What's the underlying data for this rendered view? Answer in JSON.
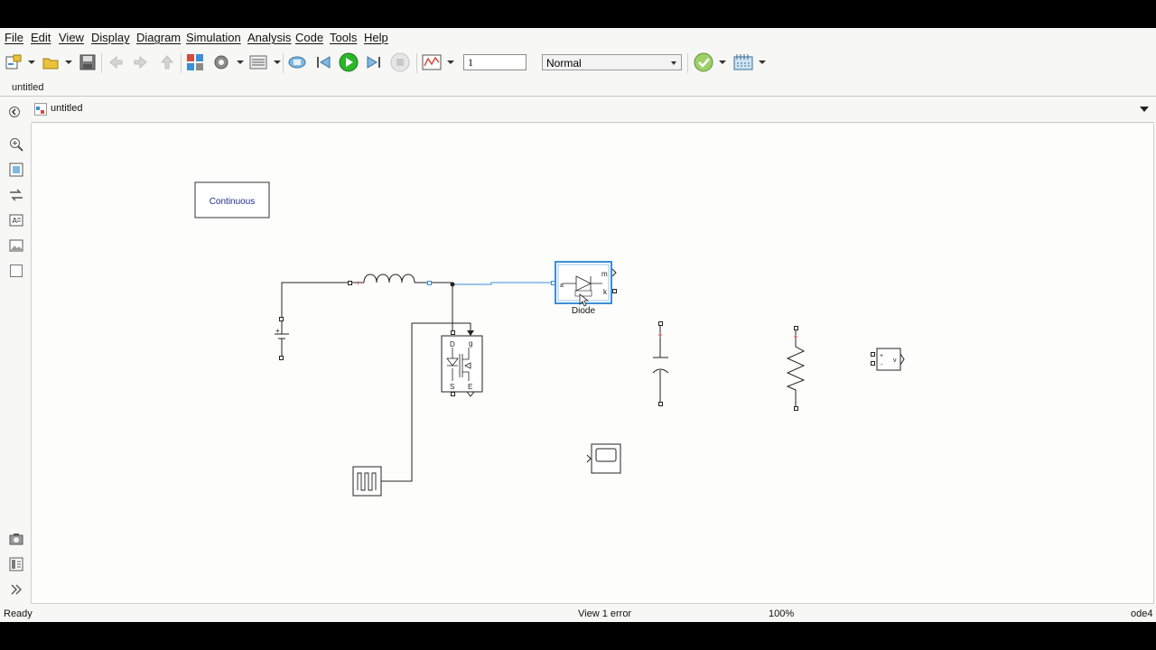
{
  "menu": {
    "items": [
      "File",
      "Edit",
      "View",
      "Display",
      "Diagram",
      "Simulation",
      "Analysis",
      "Code",
      "Tools",
      "Help"
    ]
  },
  "toolbar": {
    "stop_time": "1",
    "sim_mode": "Normal",
    "icons": [
      "new-model-icon",
      "open-icon",
      "save-icon",
      "back-icon",
      "forward-icon",
      "up-icon",
      "library-browser-icon",
      "model-settings-icon",
      "model-explorer-icon",
      "step-back-icon",
      "run-icon",
      "step-forward-icon",
      "stop-icon",
      "data-inspector-icon",
      "model-advisor-icon",
      "build-icon"
    ]
  },
  "tabs": {
    "active": "untitled"
  },
  "address": {
    "path": "untitled"
  },
  "diagram": {
    "blocks": {
      "powergui": "Continuous",
      "diode_label": "Diode",
      "diode_ports": {
        "a": "a",
        "m": "m",
        "k": "k"
      },
      "mosfet_ports": {
        "d": "D",
        "g": "g",
        "s": "S",
        "e": "E"
      },
      "vm_ports": {
        "plus": "+",
        "minus": "-",
        "v": "v"
      },
      "dc_plus": "+",
      "inductor_plus": "+"
    }
  },
  "status": {
    "left": "Ready",
    "errors": "View 1 error",
    "zoom": "100%",
    "solver": "ode4"
  },
  "colors": {
    "selection": "#3a8fd6",
    "run_green": "#2bb52b",
    "port_red": "#d23030"
  }
}
